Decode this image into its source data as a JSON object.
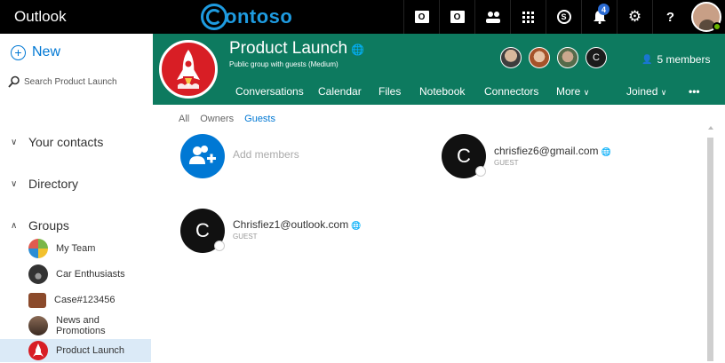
{
  "app": {
    "title": "Outlook",
    "brand": "ontoso"
  },
  "topbar": {
    "icons": [
      {
        "name": "outlook-mail-icon",
        "glyph": "O"
      },
      {
        "name": "outlook-calendar-icon",
        "glyph": "O"
      },
      {
        "name": "people-icon",
        "glyph": "👥"
      },
      {
        "name": "app-launcher-icon",
        "glyph": ""
      },
      {
        "name": "skype-icon",
        "glyph": "S"
      },
      {
        "name": "bell-icon",
        "glyph": "🔔"
      },
      {
        "name": "gear-icon",
        "glyph": "⚙"
      },
      {
        "name": "help-icon",
        "glyph": "?"
      }
    ],
    "notification_count": "4"
  },
  "left": {
    "new_label": "New",
    "search_placeholder": "Search Product Launch",
    "your_contacts": "Your contacts",
    "directory": "Directory",
    "groups": "Groups",
    "group_items": [
      {
        "label": "My Team",
        "color": "#7ab648"
      },
      {
        "label": "Car Enthusiasts",
        "color": "#444444"
      },
      {
        "label": "Case#123456",
        "color": "#8b4a2b"
      },
      {
        "label": "News and Promotions",
        "color": "#6b4a3a"
      },
      {
        "label": "Product Launch",
        "color": "#d81e25"
      }
    ]
  },
  "group": {
    "name": "Product Launch",
    "subtitle": "Public group with guests (Medium)",
    "members_label": "5 members",
    "member_initial": "C",
    "tabs": [
      "Conversations",
      "Calendar",
      "Files",
      "Notebook",
      "Connectors",
      "More",
      "Joined"
    ],
    "more_dots": "•••",
    "header_color": "#0d7a5f"
  },
  "subtabs": [
    "All",
    "Owners",
    "Guests"
  ],
  "add_members": "Add members",
  "guests": [
    {
      "initial": "C",
      "email": "chrisfiez6@gmail.com",
      "role": "GUEST"
    },
    {
      "initial": "C",
      "email": "Chrisfiez1@outlook.com",
      "role": "GUEST"
    }
  ]
}
